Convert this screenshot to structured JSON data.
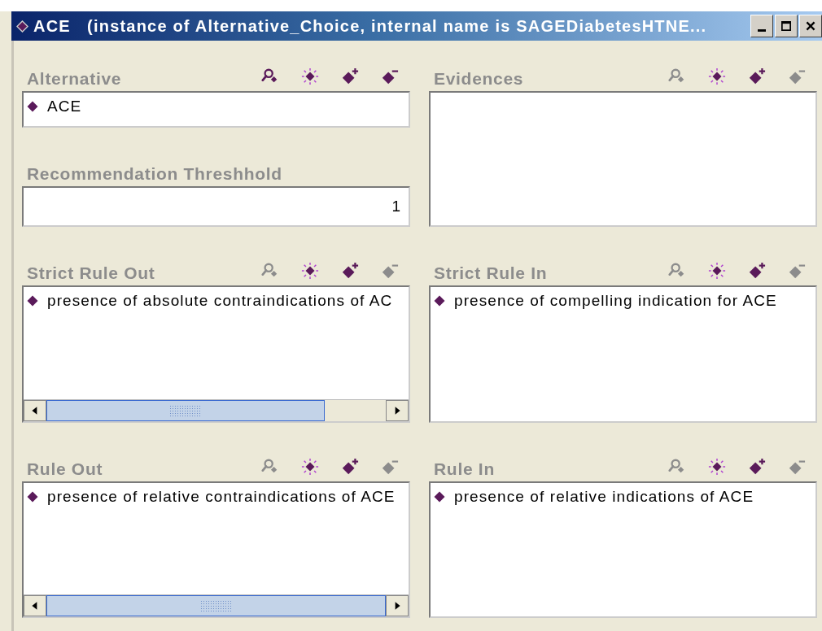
{
  "window": {
    "title": "ACE   (instance of Alternative_Choice, internal name is SAGEDiabetesHTNE..."
  },
  "panels": [
    {
      "label": "Alternative",
      "kind": "list",
      "hscroll": false,
      "icons": [
        {
          "kind": "find",
          "disabled": false
        },
        {
          "kind": "view",
          "disabled": false
        },
        {
          "kind": "add",
          "disabled": false
        },
        {
          "kind": "remove",
          "disabled": false
        }
      ],
      "items": [
        "ACE"
      ]
    },
    {
      "label": "Evidences",
      "kind": "list",
      "hscroll": false,
      "icons": [
        {
          "kind": "find",
          "disabled": true
        },
        {
          "kind": "view",
          "disabled": false
        },
        {
          "kind": "add",
          "disabled": false
        },
        {
          "kind": "remove",
          "disabled": true
        }
      ]
    },
    {
      "label": "Recommendation Threshhold",
      "kind": "field",
      "value": "1"
    },
    {
      "label": "Strict Rule Out",
      "kind": "list",
      "hscroll": true,
      "icons": [
        {
          "kind": "find",
          "disabled": true
        },
        {
          "kind": "view",
          "disabled": false
        },
        {
          "kind": "add",
          "disabled": false
        },
        {
          "kind": "remove",
          "disabled": true
        }
      ],
      "items": [
        "presence of absolute contraindications of AC"
      ]
    },
    {
      "label": "Strict Rule In",
      "kind": "list",
      "hscroll": false,
      "icons": [
        {
          "kind": "find",
          "disabled": true
        },
        {
          "kind": "view",
          "disabled": false
        },
        {
          "kind": "add",
          "disabled": false
        },
        {
          "kind": "remove",
          "disabled": true
        }
      ],
      "items": [
        "presence of compelling indication for ACE"
      ]
    },
    {
      "label": "Rule Out",
      "kind": "list",
      "hscroll": true,
      "icons": [
        {
          "kind": "find",
          "disabled": true
        },
        {
          "kind": "view",
          "disabled": false
        },
        {
          "kind": "add",
          "disabled": false
        },
        {
          "kind": "remove",
          "disabled": true
        }
      ],
      "items": [
        "presence of relative contraindications of ACE"
      ]
    },
    {
      "label": "Rule In",
      "kind": "list",
      "hscroll": false,
      "icons": [
        {
          "kind": "find",
          "disabled": true
        },
        {
          "kind": "view",
          "disabled": false
        },
        {
          "kind": "add",
          "disabled": false
        },
        {
          "kind": "remove",
          "disabled": true
        }
      ],
      "items": [
        "presence of relative indications of ACE"
      ]
    }
  ]
}
